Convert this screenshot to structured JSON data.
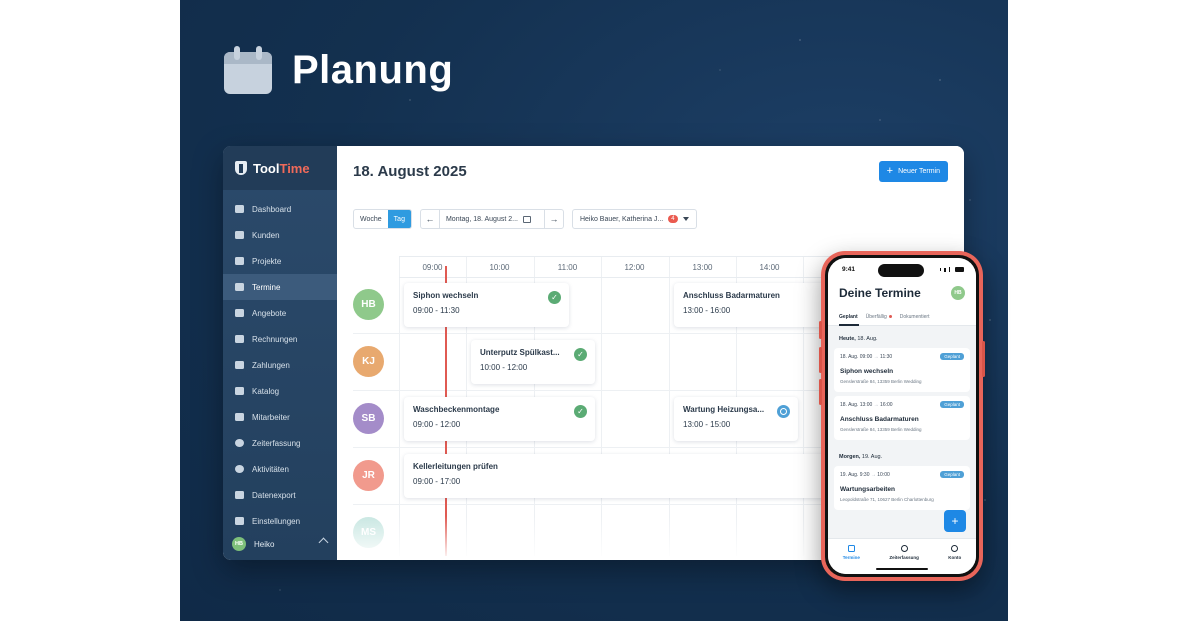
{
  "hero": {
    "title": "Planung",
    "icon": "calendar-icon"
  },
  "app": {
    "brand": {
      "name_a": "Tool",
      "name_b": "Time",
      "accent": "#f06a5a"
    },
    "nav": [
      {
        "label": "Dashboard",
        "icon": "bar-chart-icon"
      },
      {
        "label": "Kunden",
        "icon": "contact-card-icon"
      },
      {
        "label": "Projekte",
        "icon": "folder-icon"
      },
      {
        "label": "Termine",
        "icon": "calendar-icon",
        "active": true
      },
      {
        "label": "Angebote",
        "icon": "briefcase-icon"
      },
      {
        "label": "Rechnungen",
        "icon": "document-icon"
      },
      {
        "label": "Zahlungen",
        "icon": "wallet-icon"
      },
      {
        "label": "Katalog",
        "icon": "book-icon"
      },
      {
        "label": "Mitarbeiter",
        "icon": "people-icon"
      },
      {
        "label": "Zeiterfassung",
        "icon": "clock-icon"
      },
      {
        "label": "Aktivitäten",
        "icon": "history-icon"
      },
      {
        "label": "Datenexport",
        "icon": "download-icon"
      },
      {
        "label": "Einstellungen",
        "icon": "sliders-icon"
      }
    ],
    "user": {
      "initials": "HB",
      "name": "Heiko"
    },
    "header": {
      "date": "18. August 2025",
      "new_button": "Neuer Termin",
      "accent": "#1e88e5"
    },
    "toolbar": {
      "view_week": "Woche",
      "view_day": "Tag",
      "prev": "←",
      "next": "→",
      "date_value": "Montag, 18. August 2...",
      "people_value": "Heiko Bauer, Katherina J...",
      "people_badge": "4"
    },
    "hours": [
      "09:00",
      "10:00",
      "11:00",
      "12:00",
      "13:00",
      "14:00"
    ],
    "rows": [
      {
        "initials": "HB",
        "color": "#8fc98b"
      },
      {
        "initials": "KJ",
        "color": "#e8a96f"
      },
      {
        "initials": "SB",
        "color": "#a48cc9"
      },
      {
        "initials": "JR",
        "color": "#f19a8d"
      },
      {
        "initials": "MS",
        "color": "#88cbbf"
      }
    ],
    "events": [
      {
        "title": "Siphon wechseln",
        "time": "09:00 - 11:30",
        "status": "done"
      },
      {
        "title": "Anschluss Badarmaturen",
        "time": "13:00 - 16:00",
        "status": "none"
      },
      {
        "title": "Unterputz Spülkast...",
        "time": "10:00 - 12:00",
        "status": "done"
      },
      {
        "title": "Waschbeckenmontage",
        "time": "09:00 - 12:00",
        "status": "done"
      },
      {
        "title": "Wartung Heizungsa...",
        "time": "13:00 - 15:00",
        "status": "pending"
      },
      {
        "title": "Kellerleitungen prüfen",
        "time": "09:00 - 17:00",
        "status": "none"
      }
    ]
  },
  "phone": {
    "time": "9:41",
    "title": "Deine Termine",
    "avatar": "HB",
    "tabs": [
      "Geplant",
      "Überfällig",
      "Dokumentiert"
    ],
    "today_label": "Heute,",
    "today_date": "18. Aug.",
    "tomorrow_label": "Morgen,",
    "tomorrow_date": "19. Aug.",
    "cards": [
      {
        "start": "18. Aug. 09:00",
        "end": "11:30",
        "title": "Siphon wechseln",
        "address": "Genslerstraße 84, 13359 Berlin Wedding",
        "tag": "Geplant"
      },
      {
        "start": "18. Aug. 13:00",
        "end": "16:00",
        "title": "Anschluss Badarmaturen",
        "address": "Genslerstraße 84, 13359 Berlin Wedding",
        "tag": "Geplant"
      },
      {
        "start": "19. Aug. 9:30",
        "end": "10:00",
        "title": "Wartungsarbeiten",
        "address": "Leopoldstraße 71, 10627 Berlin Charlottenburg",
        "tag": "Geplant"
      }
    ],
    "fab": "+",
    "nav": [
      "Termine",
      "Zeiterfassung",
      "Konto"
    ]
  }
}
